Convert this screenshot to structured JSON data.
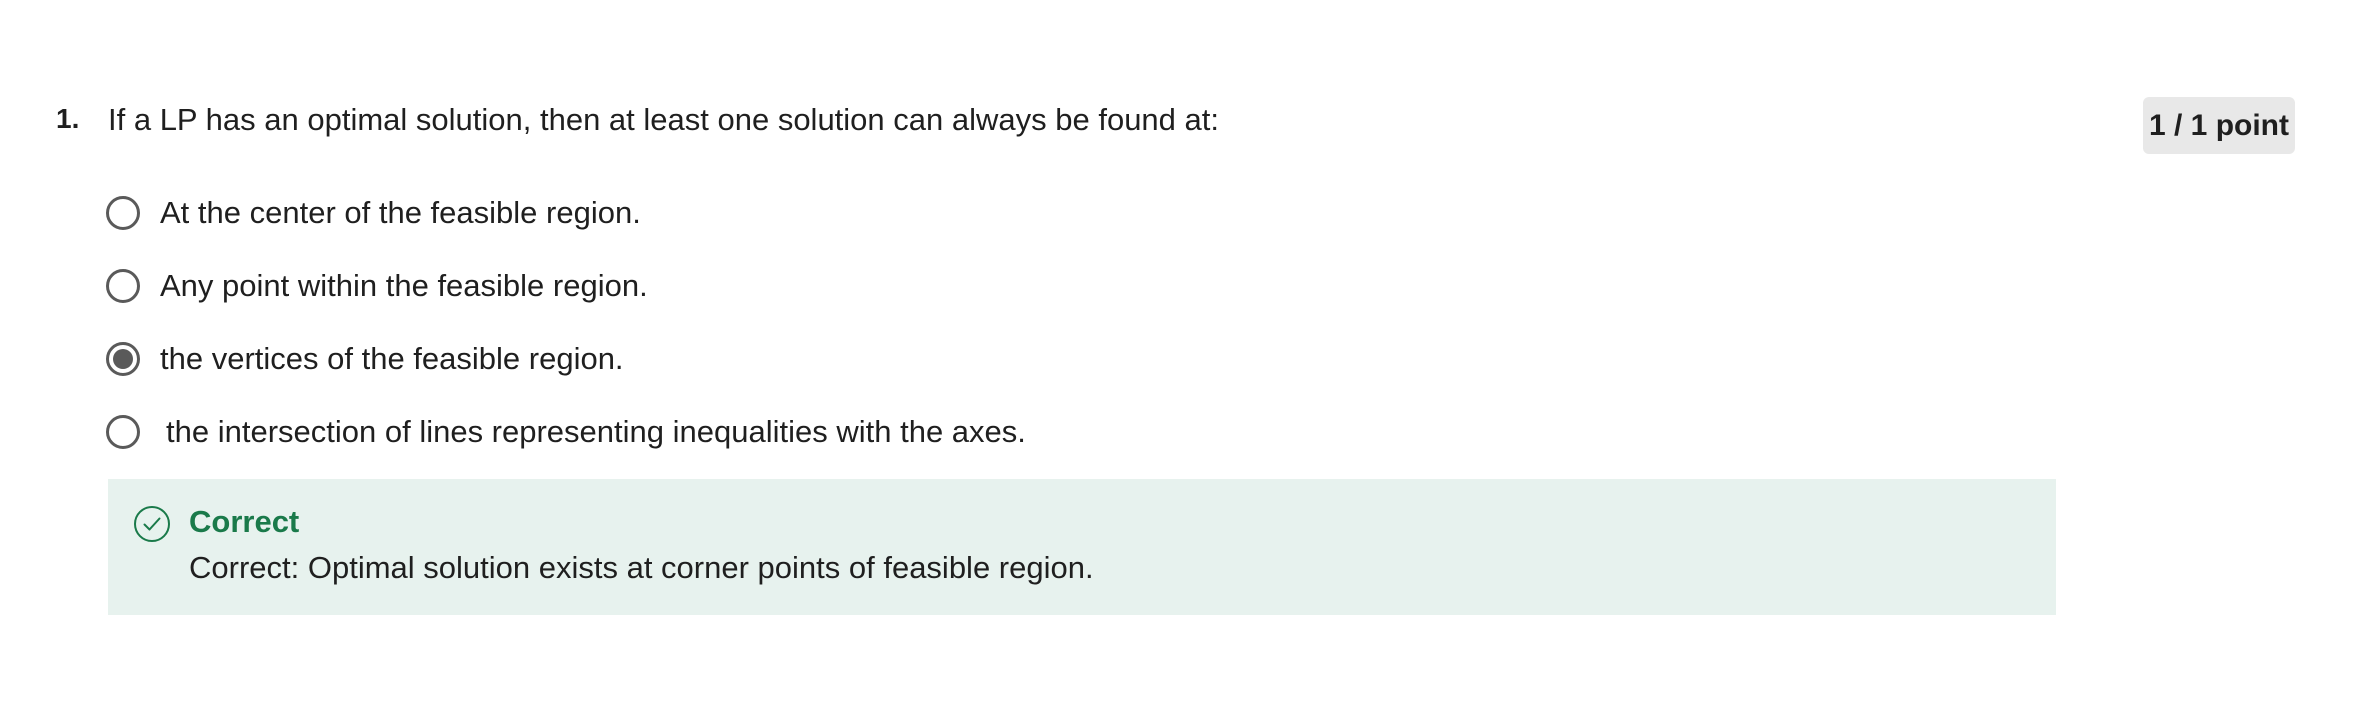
{
  "question": {
    "number": "1.",
    "text": "If a LP has an optimal solution, then at least one solution can always be found at:",
    "points": "1 / 1 point"
  },
  "options": [
    {
      "label": "At the center of the feasible region.",
      "selected": false
    },
    {
      "label": "Any point within the feasible region.",
      "selected": false
    },
    {
      "label": "the vertices of the feasible region.",
      "selected": true
    },
    {
      "label": "the intersection of lines representing inequalities with the axes.",
      "selected": false
    }
  ],
  "feedback": {
    "icon": "check-circle-icon",
    "title": "Correct",
    "text": "Correct: Optimal solution exists at corner points of feasible region.",
    "accent_color": "#1a7a4a",
    "background_color": "#e7f2ee"
  }
}
